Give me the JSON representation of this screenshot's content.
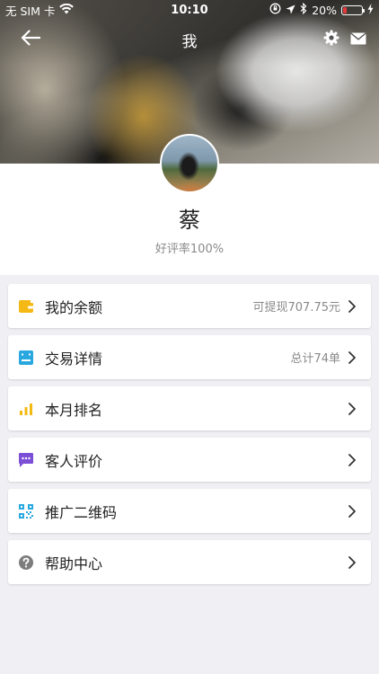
{
  "status_bar": {
    "carrier": "无 SIM 卡",
    "time": "10:10",
    "battery": "20%",
    "battery_level": 0.2
  },
  "nav": {
    "title": "我"
  },
  "profile": {
    "name": "蔡",
    "rating": "好评率100%"
  },
  "menu": {
    "items": [
      {
        "label": "我的余额",
        "value": "可提现707.75元",
        "icon": "wallet-icon",
        "color": "#f5b915"
      },
      {
        "label": "交易详情",
        "value": "总计74单",
        "icon": "receipt-icon",
        "color": "#29a8e0"
      },
      {
        "label": "本月排名",
        "value": "",
        "icon": "bar-chart-icon",
        "color": "#f5b915"
      },
      {
        "label": "客人评价",
        "value": "",
        "icon": "chat-bubble-icon",
        "color": "#7b4fd6"
      },
      {
        "label": "推广二维码",
        "value": "",
        "icon": "qr-code-icon",
        "color": "#29a8e0"
      },
      {
        "label": "帮助中心",
        "value": "",
        "icon": "help-icon",
        "color": "#7d7d7d"
      }
    ]
  }
}
